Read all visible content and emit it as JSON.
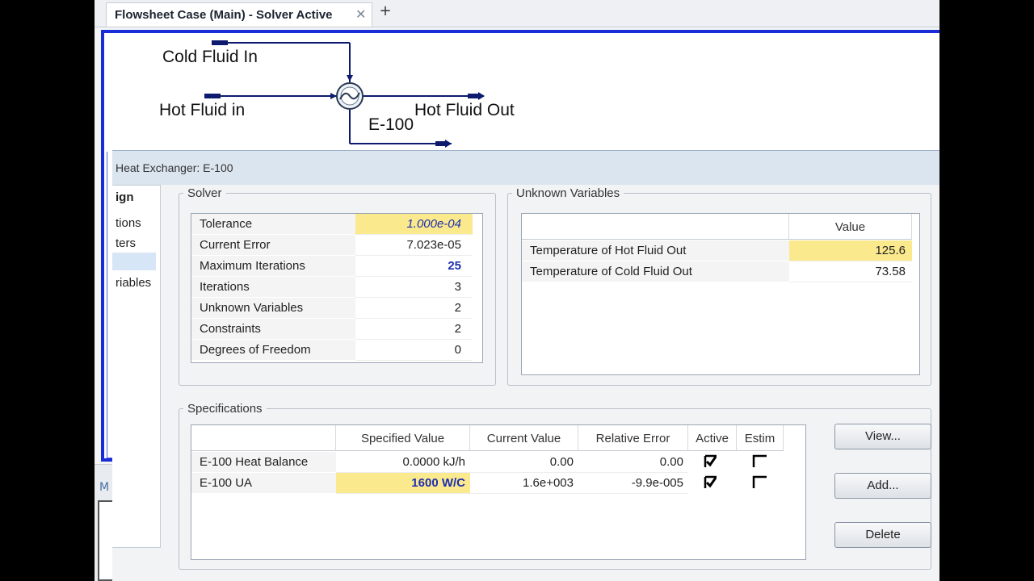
{
  "tab": {
    "title": "Flowsheet Case (Main) - Solver Active",
    "close_glyph": "✕",
    "add_glyph": "+"
  },
  "flowsheet": {
    "cold_in": "Cold Fluid In",
    "hot_in": "Hot Fluid in",
    "hot_out": "Hot Fluid Out",
    "unit": "E-100"
  },
  "side_panel": {
    "label": "M"
  },
  "dialog": {
    "title": "Heat Exchanger: E-100",
    "nav": [
      "ign",
      "tions",
      "ters",
      "",
      "riables"
    ],
    "solver": {
      "legend": "Solver",
      "rows": [
        {
          "label": "Tolerance",
          "value": "1.000e-04"
        },
        {
          "label": "Current Error",
          "value": "7.023e-05"
        },
        {
          "label": "Maximum Iterations",
          "value": "25"
        },
        {
          "label": "Iterations",
          "value": "3"
        },
        {
          "label": "Unknown Variables",
          "value": "2"
        },
        {
          "label": "Constraints",
          "value": "2"
        },
        {
          "label": "Degrees of Freedom",
          "value": "0"
        }
      ]
    },
    "unknowns": {
      "legend": "Unknown Variables",
      "header_value": "Value",
      "rows": [
        {
          "label": "Temperature of Hot Fluid Out",
          "value": "125.6"
        },
        {
          "label": "Temperature of Cold Fluid Out",
          "value": "73.58"
        }
      ]
    },
    "specs": {
      "legend": "Specifications",
      "headers": [
        "Specified Value",
        "Current Value",
        "Relative Error",
        "Active",
        "Estim"
      ],
      "rows": [
        {
          "name": "E-100 Heat Balance",
          "specified": "0.0000 kJ/h",
          "current": "0.00",
          "rel_error": "0.00",
          "active": true,
          "estim": false
        },
        {
          "name": "E-100 UA",
          "specified": "1600 W/C",
          "current": "1.6e+003",
          "rel_error": "-9.9e-005",
          "active": true,
          "estim": false
        }
      ]
    },
    "buttons": {
      "view": "View...",
      "add": "Add...",
      "delete": "Delete"
    }
  },
  "colors": {
    "stream": "#0d1a6e",
    "canvas_border": "#1a2bd8",
    "highlight": "#fbe98d",
    "spec_text": "#1d2fb0"
  }
}
